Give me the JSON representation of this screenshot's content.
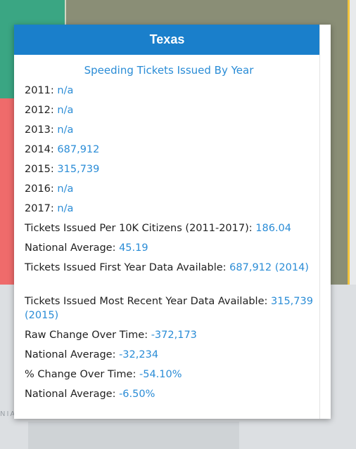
{
  "popup": {
    "title": "Texas",
    "subtitle": "Speeding Tickets Issued By Year",
    "rows": [
      {
        "label": "2011:",
        "value": "n/a"
      },
      {
        "label": "2012:",
        "value": "n/a"
      },
      {
        "label": "2013:",
        "value": "n/a"
      },
      {
        "label": "2014:",
        "value": "687,912"
      },
      {
        "label": "2015:",
        "value": "315,739"
      },
      {
        "label": "2016:",
        "value": "n/a"
      },
      {
        "label": "2017:",
        "value": "n/a"
      },
      {
        "label": "Tickets Issued Per 10K Citizens (2011-2017):",
        "value": "186.04"
      },
      {
        "label": "National Average:",
        "value": "45.19"
      },
      {
        "label": "Tickets Issued First Year Data Available:",
        "value": "687,912 (2014)"
      },
      {
        "label": "Tickets Issued Most Recent Year Data Available:",
        "value": "315,739 (2015)"
      },
      {
        "label": "Raw Change Over Time:",
        "value": "-372,173"
      },
      {
        "label": "National Average:",
        "value": "-32,234"
      },
      {
        "label": "% Change Over Time:",
        "value": "-54.10%"
      },
      {
        "label": "National Average:",
        "value": "-6.50%"
      }
    ]
  },
  "map": {
    "partial_label": "NIA",
    "colors": {
      "teal": "#3aa683",
      "red": "#ef6b6b",
      "olive": "#8a8e76",
      "yellow": "#f1c33c",
      "header_blue": "#1a7fcb",
      "value_blue": "#2a8cd6"
    }
  }
}
